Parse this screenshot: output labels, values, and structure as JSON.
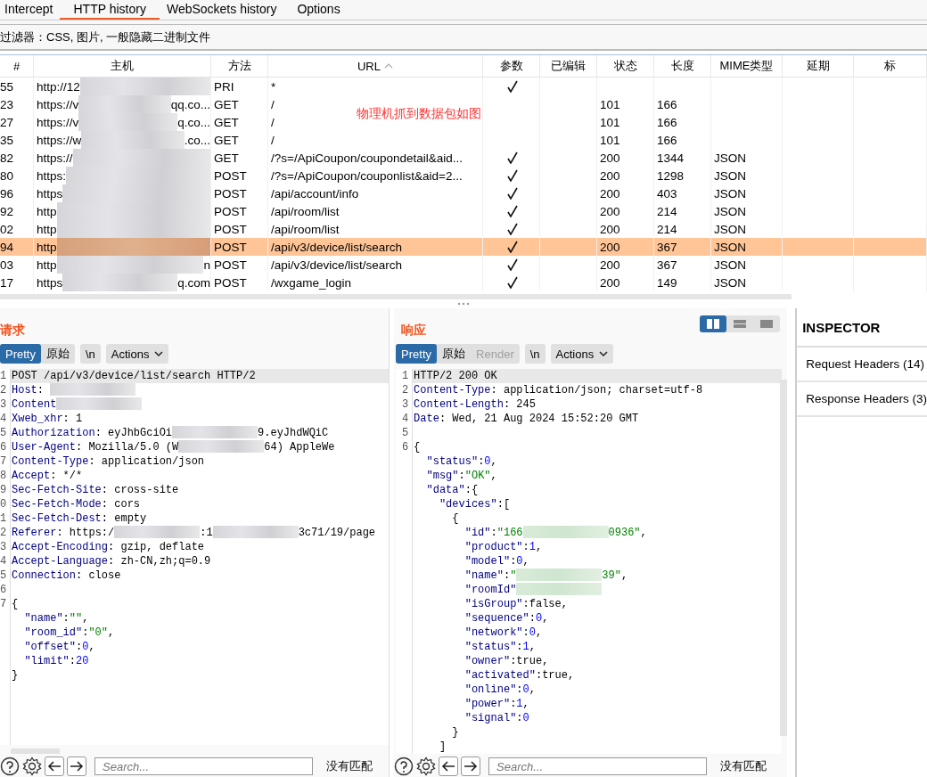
{
  "tabs": [
    {
      "label": "Intercept",
      "selected": false
    },
    {
      "label": "HTTP history",
      "selected": true
    },
    {
      "label": "WebSockets history",
      "selected": false
    },
    {
      "label": "Options",
      "selected": false
    }
  ],
  "filter": "过滤器：CSS, 图片, 一般隐藏二进制文件",
  "table": {
    "columns": [
      {
        "label": "#"
      },
      {
        "label": "主机"
      },
      {
        "label": "方法"
      },
      {
        "label": "URL",
        "sorted": true
      },
      {
        "label": "参数"
      },
      {
        "label": "已编辑"
      },
      {
        "label": "状态"
      },
      {
        "label": "长度"
      },
      {
        "label": "MIME类型"
      },
      {
        "label": "延期"
      },
      {
        "label": "标"
      }
    ],
    "rows": [
      {
        "num": "55",
        "host": [
          {
            "kind": "text",
            "text": "http://12"
          },
          {
            "kind": "blur"
          }
        ],
        "method": "PRI",
        "url": "*",
        "params": true,
        "selected": false
      },
      {
        "num": "23",
        "host": [
          {
            "kind": "text",
            "text": "https://v"
          },
          {
            "kind": "blur"
          },
          {
            "kind": "text",
            "text": "qq.co..."
          }
        ],
        "method": "GET",
        "url": "/",
        "params": false,
        "status": "101",
        "length": "166",
        "selected": false
      },
      {
        "num": "27",
        "host": [
          {
            "kind": "text",
            "text": "https://v"
          },
          {
            "kind": "blur"
          },
          {
            "kind": "text",
            "text": "q.co..."
          }
        ],
        "method": "GET",
        "url": "/",
        "params": false,
        "status": "101",
        "length": "166",
        "selected": false
      },
      {
        "num": "35",
        "host": [
          {
            "kind": "text",
            "text": "https://w"
          },
          {
            "kind": "blur"
          },
          {
            "kind": "text",
            "text": ".co..."
          }
        ],
        "method": "GET",
        "url": "/",
        "params": false,
        "status": "101",
        "length": "166",
        "selected": false
      },
      {
        "num": "82",
        "host": [
          {
            "kind": "text",
            "text": "https://"
          },
          {
            "kind": "blur"
          }
        ],
        "method": "GET",
        "url": "/?s=/ApiCoupon/coupondetail&aid...",
        "params": true,
        "status": "200",
        "length": "1344",
        "mime": "JSON",
        "selected": false
      },
      {
        "num": "80",
        "host": [
          {
            "kind": "text",
            "text": "https:"
          },
          {
            "kind": "blur"
          }
        ],
        "method": "POST",
        "url": "/?s=/ApiCoupon/couponlist&aid=2...",
        "params": true,
        "status": "200",
        "length": "1298",
        "mime": "JSON",
        "selected": false
      },
      {
        "num": "96",
        "host": [
          {
            "kind": "text",
            "text": "https"
          },
          {
            "kind": "blur"
          }
        ],
        "method": "POST",
        "url": "/api/account/info",
        "params": true,
        "status": "200",
        "length": "403",
        "mime": "JSON",
        "selected": false
      },
      {
        "num": "92",
        "host": [
          {
            "kind": "text",
            "text": "http"
          },
          {
            "kind": "blur"
          }
        ],
        "method": "POST",
        "url": "/api/room/list",
        "params": true,
        "status": "200",
        "length": "214",
        "mime": "JSON",
        "selected": false
      },
      {
        "num": "02",
        "host": [
          {
            "kind": "text",
            "text": "http"
          },
          {
            "kind": "blur"
          }
        ],
        "method": "POST",
        "url": "/api/room/list",
        "params": true,
        "status": "200",
        "length": "214",
        "mime": "JSON",
        "selected": false
      },
      {
        "num": "94",
        "host": [
          {
            "kind": "text",
            "text": "http"
          },
          {
            "kind": "blur"
          }
        ],
        "method": "POST",
        "url": "/api/v3/device/list/search",
        "params": true,
        "status": "200",
        "length": "367",
        "mime": "JSON",
        "selected": true
      },
      {
        "num": "03",
        "host": [
          {
            "kind": "text",
            "text": "http"
          },
          {
            "kind": "blur"
          },
          {
            "kind": "text",
            "text": "n"
          }
        ],
        "method": "POST",
        "url": "/api/v3/device/list/search",
        "params": true,
        "status": "200",
        "length": "367",
        "mime": "JSON",
        "selected": false
      },
      {
        "num": "17",
        "host": [
          {
            "kind": "text",
            "text": "https"
          },
          {
            "kind": "blur"
          },
          {
            "kind": "text",
            "text": "q.com"
          }
        ],
        "method": "POST",
        "url": "/wxgame_login",
        "params": true,
        "status": "200",
        "length": "149",
        "mime": "JSON",
        "selected": false
      }
    ]
  },
  "annotation": "物理机抓到数据包如图",
  "request": {
    "title": "请求",
    "view_tabs": [
      {
        "label": "Pretty",
        "selected": true,
        "disabled": false
      },
      {
        "label": "原始",
        "selected": false,
        "disabled": false
      }
    ],
    "newline_button": "\\n",
    "actions": "Actions",
    "lines": [
      {
        "n": "1",
        "current": true,
        "segs": [
          {
            "kind": "text",
            "text": "POST /api/v3/device/list/search HTTP/2"
          }
        ]
      },
      {
        "n": "2",
        "segs": [
          {
            "kind": "key",
            "text": "Host"
          },
          {
            "kind": "text",
            "text": ": "
          },
          {
            "kind": "blur"
          }
        ]
      },
      {
        "n": "3",
        "segs": [
          {
            "kind": "key",
            "text": "Content"
          },
          {
            "kind": "blur"
          }
        ]
      },
      {
        "n": "4",
        "segs": [
          {
            "kind": "key",
            "text": "Xweb_xhr"
          },
          {
            "kind": "text",
            "text": ": 1"
          }
        ]
      },
      {
        "n": "5",
        "segs": [
          {
            "kind": "key",
            "text": "Authorization"
          },
          {
            "kind": "text",
            "text": ": eyJhbGciOi"
          },
          {
            "kind": "blur"
          },
          {
            "kind": "text",
            "text": "9.eyJhdWQiC"
          }
        ]
      },
      {
        "n": "6",
        "segs": [
          {
            "kind": "key",
            "text": "User-Agent"
          },
          {
            "kind": "text",
            "text": ": Mozilla/5.0 (W"
          },
          {
            "kind": "blur"
          },
          {
            "kind": "text",
            "text": "64) AppleWe"
          }
        ]
      },
      {
        "n": "7",
        "current": false,
        "segs": [
          {
            "kind": "key",
            "text": "Content-Type"
          },
          {
            "kind": "text",
            "text": ": application/json"
          }
        ]
      },
      {
        "n": "8",
        "current": false,
        "segs": [
          {
            "kind": "key",
            "text": "Accept"
          },
          {
            "kind": "text",
            "text": ": */*"
          }
        ]
      },
      {
        "n": "9",
        "current": false,
        "segs": [
          {
            "kind": "key",
            "text": "Sec-Fetch-Site"
          },
          {
            "kind": "text",
            "text": ": cross-site"
          }
        ]
      },
      {
        "n": "0",
        "current": false,
        "segs": [
          {
            "kind": "key",
            "text": "Sec-Fetch-Mode"
          },
          {
            "kind": "text",
            "text": ": cors"
          }
        ]
      },
      {
        "n": "1",
        "current": false,
        "segs": [
          {
            "kind": "key",
            "text": "Sec-Fetch-Dest"
          },
          {
            "kind": "text",
            "text": ": empty"
          }
        ]
      },
      {
        "n": "2",
        "current": false,
        "segs": [
          {
            "kind": "key",
            "text": "Referer"
          },
          {
            "kind": "text",
            "text": ": https:/"
          },
          {
            "kind": "blur"
          },
          {
            "kind": "text",
            "text": ":1"
          },
          {
            "kind": "blur"
          },
          {
            "kind": "text",
            "text": "3c71/19/page"
          }
        ]
      },
      {
        "n": "3",
        "current": false,
        "segs": [
          {
            "kind": "key",
            "text": "Accept-Encoding"
          },
          {
            "kind": "text",
            "text": ": gzip, deflate"
          }
        ]
      },
      {
        "n": "4",
        "current": false,
        "segs": [
          {
            "kind": "key",
            "text": "Accept-Language"
          },
          {
            "kind": "text",
            "text": ": zh-CN,zh;q=0.9"
          }
        ]
      },
      {
        "n": "5",
        "current": false,
        "segs": [
          {
            "kind": "key",
            "text": "Connection"
          },
          {
            "kind": "text",
            "text": ": close"
          }
        ]
      },
      {
        "n": "6"
      },
      {
        "n": "7",
        "segs": [
          {
            "kind": "text",
            "text": "{"
          }
        ]
      },
      {
        "current": false,
        "segs": [
          {
            "kind": "key",
            "text": "  \"name\""
          },
          {
            "kind": "text",
            "text": ":"
          },
          {
            "kind": "str",
            "text": "\"\""
          },
          {
            "kind": "text",
            "text": ","
          }
        ]
      },
      {
        "current": false,
        "segs": [
          {
            "kind": "key",
            "text": "  \"room_id\""
          },
          {
            "kind": "text",
            "text": ":"
          },
          {
            "kind": "str",
            "text": "\"0\""
          },
          {
            "kind": "text",
            "text": ","
          }
        ]
      },
      {
        "current": false,
        "segs": [
          {
            "kind": "key",
            "text": "  \"offset\""
          },
          {
            "kind": "text",
            "text": ":"
          },
          {
            "kind": "num",
            "text": "0"
          },
          {
            "kind": "text",
            "text": ","
          }
        ]
      },
      {
        "current": false,
        "segs": [
          {
            "kind": "key",
            "text": "  \"limit\""
          },
          {
            "kind": "text",
            "text": ":"
          },
          {
            "kind": "num",
            "text": "20"
          }
        ]
      },
      {
        "current": false,
        "segs": [
          {
            "kind": "text",
            "text": "}"
          }
        ]
      }
    ],
    "search": {
      "placeholder": "Search..."
    },
    "match_status": "没有匹配"
  },
  "response": {
    "title": "响应",
    "layout_buttons": [
      {
        "kind": "split",
        "selected": true
      },
      {
        "kind": "stack",
        "selected": false
      },
      {
        "kind": "single",
        "selected": false
      }
    ],
    "view_tabs": [
      {
        "label": "Pretty",
        "selected": true,
        "disabled": false
      },
      {
        "label": "原始",
        "selected": false,
        "disabled": false
      },
      {
        "label": "Render",
        "selected": false,
        "disabled": true
      }
    ],
    "newline_button": "\\n",
    "actions": "Actions",
    "lines": [
      {
        "n": "1",
        "current": true,
        "segs": [
          {
            "kind": "text",
            "text": "HTTP/2 200 OK"
          }
        ]
      },
      {
        "n": "2",
        "current": false,
        "segs": [
          {
            "kind": "key",
            "text": "Content-Type"
          },
          {
            "kind": "text",
            "text": ": application/json; charset=utf-8"
          }
        ]
      },
      {
        "n": "3",
        "current": false,
        "segs": [
          {
            "kind": "key",
            "text": "Content-Length"
          },
          {
            "kind": "text",
            "text": ": 245"
          }
        ]
      },
      {
        "n": "4",
        "current": false,
        "segs": [
          {
            "kind": "key",
            "text": "Date"
          },
          {
            "kind": "text",
            "text": ": Wed, 21 Aug 2024 15:52:20 GMT"
          }
        ]
      },
      {
        "n": "5"
      },
      {
        "n": "6",
        "segs": [
          {
            "kind": "text",
            "text": "{"
          }
        ]
      },
      {
        "current": false,
        "segs": [
          {
            "kind": "key",
            "text": "  \"status\""
          },
          {
            "kind": "text",
            "text": ":"
          },
          {
            "kind": "num",
            "text": "0"
          },
          {
            "kind": "text",
            "text": ","
          }
        ]
      },
      {
        "current": false,
        "segs": [
          {
            "kind": "key",
            "text": "  \"msg\""
          },
          {
            "kind": "text",
            "text": ":"
          },
          {
            "kind": "str",
            "text": "\"OK\""
          },
          {
            "kind": "text",
            "text": ","
          }
        ]
      },
      {
        "current": false,
        "segs": [
          {
            "kind": "key",
            "text": "  \"data\""
          },
          {
            "kind": "text",
            "text": ":{"
          }
        ]
      },
      {
        "current": false,
        "segs": [
          {
            "kind": "key",
            "text": "    \"devices\""
          },
          {
            "kind": "text",
            "text": ":["
          }
        ]
      },
      {
        "current": false,
        "segs": [
          {
            "kind": "text",
            "text": "      {"
          }
        ]
      },
      {
        "current": false,
        "segs": [
          {
            "kind": "key",
            "text": "        \"id\""
          },
          {
            "kind": "text",
            "text": ":"
          },
          {
            "kind": "str",
            "text": "\"166"
          },
          {
            "kind": "blur"
          },
          {
            "kind": "str",
            "text": "0936\""
          },
          {
            "kind": "text",
            "text": ","
          }
        ]
      },
      {
        "current": false,
        "segs": [
          {
            "kind": "key",
            "text": "        \"product\""
          },
          {
            "kind": "text",
            "text": ":"
          },
          {
            "kind": "num",
            "text": "1"
          },
          {
            "kind": "text",
            "text": ","
          }
        ]
      },
      {
        "current": false,
        "segs": [
          {
            "kind": "key",
            "text": "        \"model\""
          },
          {
            "kind": "text",
            "text": ":"
          },
          {
            "kind": "num",
            "text": "0"
          },
          {
            "kind": "text",
            "text": ","
          }
        ]
      },
      {
        "current": false,
        "segs": [
          {
            "kind": "key",
            "text": "        \"name\""
          },
          {
            "kind": "text",
            "text": ":"
          },
          {
            "kind": "str",
            "text": "\""
          },
          {
            "kind": "blur"
          },
          {
            "kind": "str",
            "text": "39\""
          },
          {
            "kind": "text",
            "text": ","
          }
        ]
      },
      {
        "current": false,
        "segs": [
          {
            "kind": "key",
            "text": "        \"roomId\""
          },
          {
            "kind": "blur"
          }
        ]
      },
      {
        "current": false,
        "segs": [
          {
            "kind": "key",
            "text": "        \"isGroup\""
          },
          {
            "kind": "text",
            "text": ":false,"
          }
        ]
      },
      {
        "current": false,
        "segs": [
          {
            "kind": "key",
            "text": "        \"sequence\""
          },
          {
            "kind": "text",
            "text": ":"
          },
          {
            "kind": "num",
            "text": "0"
          },
          {
            "kind": "text",
            "text": ","
          }
        ]
      },
      {
        "current": false,
        "segs": [
          {
            "kind": "key",
            "text": "        \"network\""
          },
          {
            "kind": "text",
            "text": ":"
          },
          {
            "kind": "num",
            "text": "0"
          },
          {
            "kind": "text",
            "text": ","
          }
        ]
      },
      {
        "current": false,
        "segs": [
          {
            "kind": "key",
            "text": "        \"status\""
          },
          {
            "kind": "text",
            "text": ":"
          },
          {
            "kind": "num",
            "text": "1"
          },
          {
            "kind": "text",
            "text": ","
          }
        ]
      },
      {
        "current": false,
        "segs": [
          {
            "kind": "key",
            "text": "        \"owner\""
          },
          {
            "kind": "text",
            "text": ":true,"
          }
        ]
      },
      {
        "current": false,
        "segs": [
          {
            "kind": "key",
            "text": "        \"activated\""
          },
          {
            "kind": "text",
            "text": ":true,"
          }
        ]
      },
      {
        "current": false,
        "segs": [
          {
            "kind": "key",
            "text": "        \"online\""
          },
          {
            "kind": "text",
            "text": ":"
          },
          {
            "kind": "num",
            "text": "0"
          },
          {
            "kind": "text",
            "text": ","
          }
        ]
      },
      {
        "current": false,
        "segs": [
          {
            "kind": "key",
            "text": "        \"power\""
          },
          {
            "kind": "text",
            "text": ":"
          },
          {
            "kind": "num",
            "text": "1"
          },
          {
            "kind": "text",
            "text": ","
          }
        ]
      },
      {
        "current": false,
        "segs": [
          {
            "kind": "key",
            "text": "        \"signal\""
          },
          {
            "kind": "text",
            "text": ":"
          },
          {
            "kind": "num",
            "text": "0"
          }
        ]
      },
      {
        "current": false,
        "segs": [
          {
            "kind": "text",
            "text": "      }"
          }
        ]
      },
      {
        "current": false,
        "segs": [
          {
            "kind": "text",
            "text": "    ]"
          }
        ]
      }
    ],
    "search": {
      "placeholder": "Search..."
    },
    "match_status": "没有匹配"
  },
  "inspector": {
    "title": "INSPECTOR",
    "sections": [
      {
        "label": "Request Headers (14)"
      },
      {
        "label": "Response Headers (3)"
      }
    ]
  }
}
